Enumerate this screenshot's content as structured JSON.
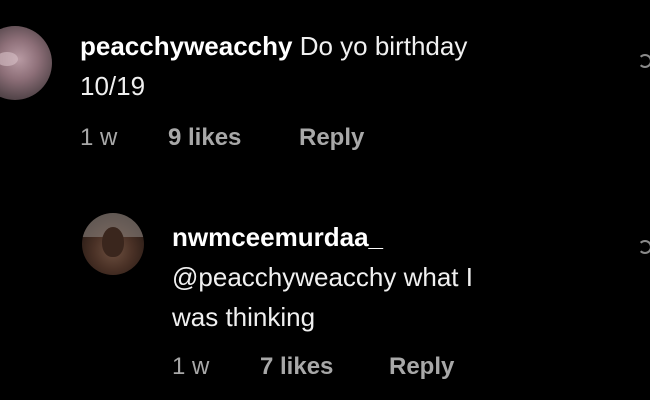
{
  "comments": [
    {
      "username": "peacchyweacchy",
      "text_line1": "Do yo birthday",
      "text_line2": "10/19",
      "time": "1 w",
      "likes": "9 likes",
      "reply": "Reply"
    },
    {
      "username": "nwmceemurdaa_",
      "text_line1": "@peacchyweacchy what I",
      "text_line2": "was thinking",
      "time": "1 w",
      "likes": "7 likes",
      "reply": "Reply"
    }
  ],
  "icons": {
    "like": "heart-icon"
  }
}
